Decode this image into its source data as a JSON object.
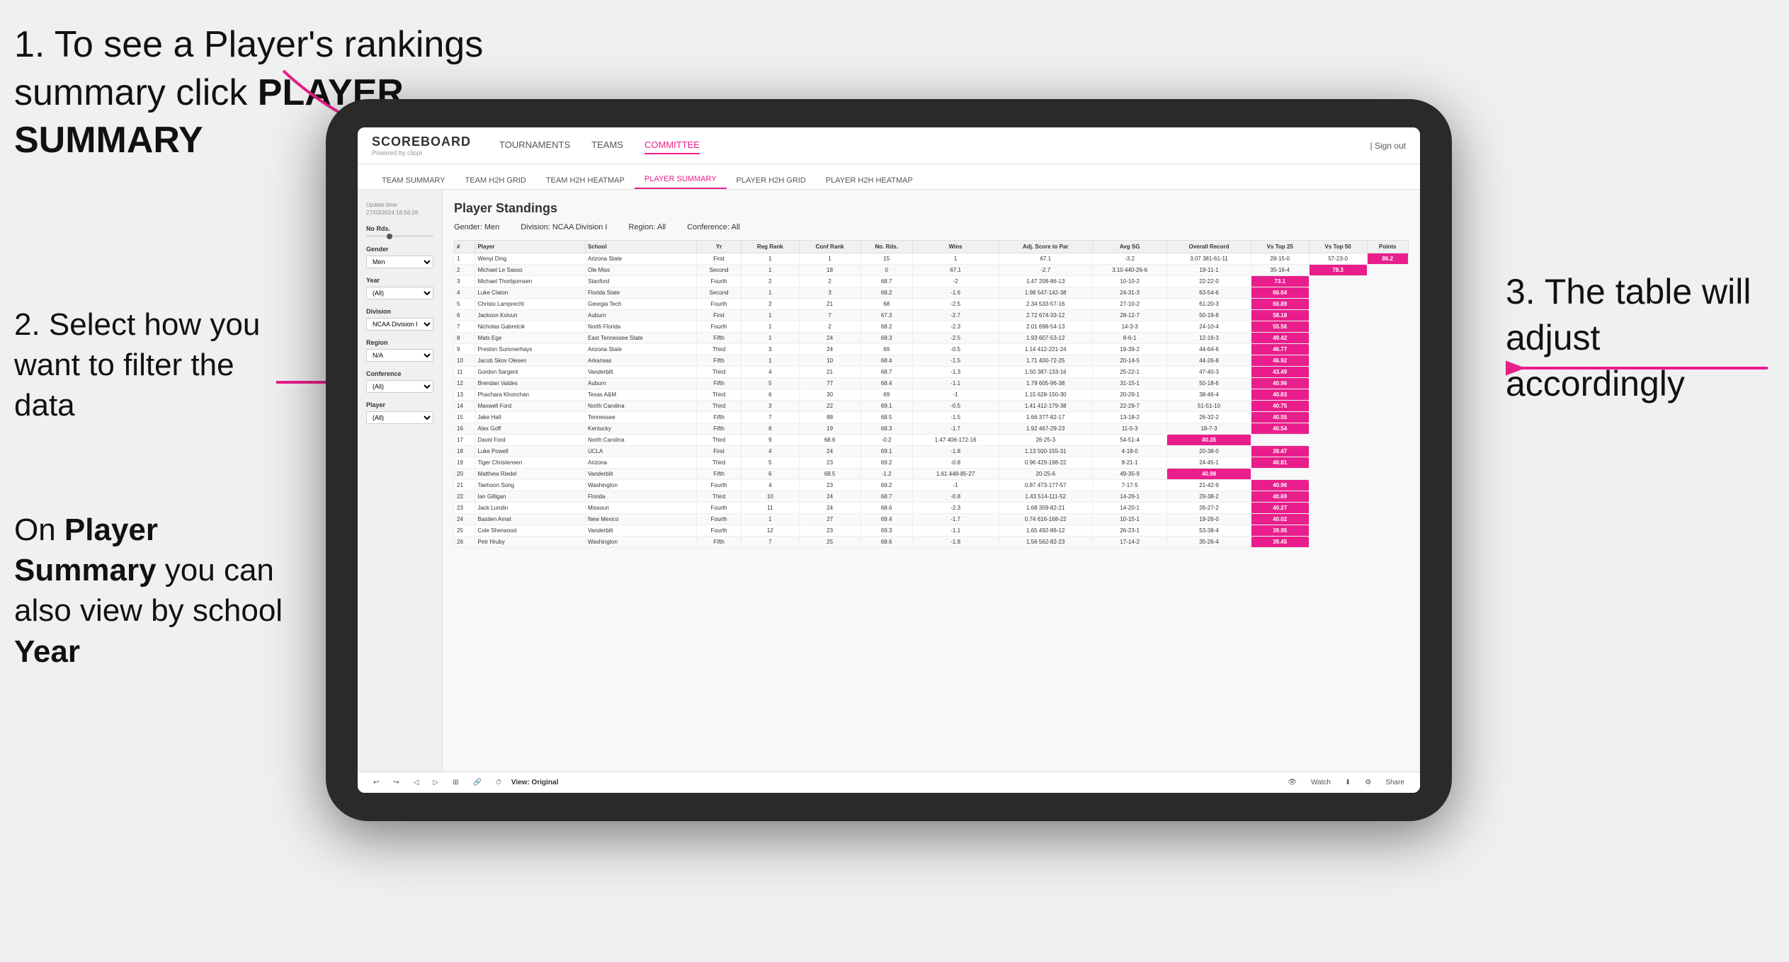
{
  "annotations": {
    "step1": "1. To see a Player's rankings summary click ",
    "step1_bold": "PLAYER SUMMARY",
    "step2_title": "2. Select how you want to filter the data",
    "step2_body_prefix": "On ",
    "step2_body_bold1": "Player Summary",
    "step2_body_mid": " you can also view by school ",
    "step2_body_bold2": "Year",
    "step3": "3. The table will adjust accordingly"
  },
  "nav": {
    "logo": "SCOREBOARD",
    "logo_sub": "Powered by clippi",
    "items": [
      "TOURNAMENTS",
      "TEAMS",
      "COMMITTEE"
    ],
    "active_item": "COMMITTEE",
    "right": [
      "| Sign out"
    ]
  },
  "sub_nav": {
    "items": [
      "TEAM SUMMARY",
      "TEAM H2H GRID",
      "TEAM H2H HEATMAP",
      "PLAYER SUMMARY",
      "PLAYER H2H GRID",
      "PLAYER H2H HEATMAP"
    ],
    "active": "PLAYER SUMMARY"
  },
  "sidebar": {
    "update_label": "Update time:",
    "update_time": "27/03/2024 16:56:26",
    "no_rds_label": "No Rds.",
    "gender_label": "Gender",
    "gender_value": "Men",
    "year_label": "Year",
    "year_value": "(All)",
    "division_label": "Division",
    "division_value": "NCAA Division I",
    "region_label": "Region",
    "region_value": "N/A",
    "conference_label": "Conference",
    "conference_value": "(All)",
    "player_label": "Player",
    "player_value": "(All)"
  },
  "table": {
    "title": "Player Standings",
    "filters": {
      "gender_label": "Gender:",
      "gender_value": "Men",
      "division_label": "Division:",
      "division_value": "NCAA Division I",
      "region_label": "Region:",
      "region_value": "All",
      "conference_label": "Conference:",
      "conference_value": "All"
    },
    "headers": [
      "#",
      "Player",
      "School",
      "Yr",
      "Reg Rank",
      "Conf Rank",
      "No. Rds.",
      "Wins",
      "Adj. Score to Par",
      "Avg SG",
      "Overall Record",
      "Vs Top 25",
      "Vs Top 50",
      "Points"
    ],
    "rows": [
      [
        1,
        "Wenyi Ding",
        "Arizona State",
        "First",
        1,
        1,
        15,
        1,
        67.1,
        -3.2,
        "3.07 381-61-11",
        "28-15-0",
        "57-23-0",
        "86.2"
      ],
      [
        2,
        "Michael Le Sasso",
        "Ole Miss",
        "Second",
        1,
        18,
        0,
        67.1,
        -2.7,
        "3.10 440-26-6",
        "19-11-1",
        "35-16-4",
        "78.3"
      ],
      [
        3,
        "Michael Thorbjornsen",
        "Stanford",
        "Fourth",
        2,
        2,
        68.7,
        -2.0,
        "1.47 208-86-13",
        "10-10-2",
        "22-22-0",
        "73.1"
      ],
      [
        4,
        "Luke Claton",
        "Florida State",
        "Second",
        1,
        3,
        68.2,
        -1.6,
        "1.98 547-142-38",
        "24-31-3",
        "63-54-6",
        "66.04"
      ],
      [
        5,
        "Christo Lamprecht",
        "Georgia Tech",
        "Fourth",
        2,
        21,
        68.0,
        -2.5,
        "2.34 533-57-16",
        "27-10-2",
        "61-20-3",
        "60.89"
      ],
      [
        6,
        "Jackson Koivun",
        "Auburn",
        "First",
        1,
        7,
        67.3,
        -2.7,
        "2.72 674-33-12",
        "28-12-7",
        "50-19-8",
        "58.18"
      ],
      [
        7,
        "Nicholas Gabrelcik",
        "North Florida",
        "Fourth",
        1,
        2,
        68.2,
        -2.3,
        "2.01 698-54-13",
        "14-3-3",
        "24-10-4",
        "55.56"
      ],
      [
        8,
        "Mats Ege",
        "East Tennessee State",
        "Fifth",
        1,
        24,
        68.3,
        -2.5,
        "1.93 607-53-12",
        "8-6-1",
        "12-16-3",
        "49.42"
      ],
      [
        9,
        "Preston Summerhays",
        "Arizona State",
        "Third",
        3,
        24,
        69.0,
        -0.5,
        "1.14 412-221-24",
        "19-39-2",
        "44-64-6",
        "46.77"
      ],
      [
        10,
        "Jacob Skov Olesen",
        "Arkansas",
        "Fifth",
        1,
        10,
        68.4,
        -1.5,
        "1.71 400-72-25",
        "20-14-5",
        "44-26-8",
        "46.92"
      ],
      [
        11,
        "Gordon Sargent",
        "Vanderbilt",
        "Third",
        4,
        21,
        68.7,
        -1.3,
        "1.50 387-133-16",
        "25-22-1",
        "47-40-3",
        "43.49"
      ],
      [
        12,
        "Brendan Valdes",
        "Auburn",
        "Fifth",
        5,
        77,
        68.4,
        -1.1,
        "1.79 605-96-38",
        "31-15-1",
        "50-18-6",
        "40.96"
      ],
      [
        13,
        "Phachara Khonchan",
        "Texas A&M",
        "Third",
        6,
        30,
        69.0,
        -1.0,
        "1.15 628-150-30",
        "20-29-1",
        "38-46-4",
        "40.83"
      ],
      [
        14,
        "Maxwell Ford",
        "North Carolina",
        "Third",
        3,
        22,
        69.1,
        -0.5,
        "1.41 412-179-38",
        "22-29-7",
        "51-51-10",
        "40.75"
      ],
      [
        15,
        "Jake Hall",
        "Tennessee",
        "Fifth",
        7,
        88,
        68.5,
        -1.5,
        "1.66 377-82-17",
        "13-18-2",
        "26-32-2",
        "40.55"
      ],
      [
        16,
        "Alex Goff",
        "Kentucky",
        "Fifth",
        8,
        19,
        68.3,
        -1.7,
        "1.92 467-29-23",
        "11-5-3",
        "18-7-3",
        "40.54"
      ],
      [
        17,
        "David Ford",
        "North Carolina",
        "Third",
        9,
        68.6,
        -0.2,
        "1.47 406-172-16",
        "26-25-3",
        "54-51-4",
        "40.35"
      ],
      [
        18,
        "Luke Powell",
        "UCLA",
        "First",
        4,
        24,
        69.1,
        -1.8,
        "1.13 500-155-31",
        "4-18-0",
        "20-38-0",
        "39.47"
      ],
      [
        19,
        "Tiger Christensen",
        "Arizona",
        "Third",
        5,
        23,
        69.2,
        -0.8,
        "0.96 429-198-22",
        "8-21-1",
        "24-45-1",
        "40.81"
      ],
      [
        20,
        "Matthew Riedel",
        "Vanderbilt",
        "Fifth",
        6,
        68.5,
        -1.2,
        "1.61 448-85-27",
        "20-25-6",
        "49-35-9",
        "40.98"
      ],
      [
        21,
        "Taehoon Song",
        "Washington",
        "Fourth",
        4,
        23,
        69.2,
        -1.0,
        "0.87 473-177-57",
        "7-17-5",
        "21-42-9",
        "40.96"
      ],
      [
        22,
        "Ian Gilligan",
        "Florida",
        "Third",
        10,
        24,
        68.7,
        -0.8,
        "1.43 514-111-52",
        "14-26-1",
        "29-38-2",
        "40.69"
      ],
      [
        23,
        "Jack Lundin",
        "Missouri",
        "Fourth",
        11,
        24,
        68.6,
        -2.3,
        "1.68 309-82-21",
        "14-20-1",
        "26-27-2",
        "40.27"
      ],
      [
        24,
        "Bastien Amat",
        "New Mexico",
        "Fourth",
        1,
        27,
        69.4,
        -1.7,
        "0.74 616-168-22",
        "10-15-1",
        "19-26-0",
        "40.02"
      ],
      [
        25,
        "Cole Sherwood",
        "Vanderbilt",
        "Fourth",
        12,
        23,
        69.3,
        -1.1,
        "1.65 492-86-12",
        "26-23-1",
        "53-38-4",
        "39.95"
      ],
      [
        26,
        "Petr Hruby",
        "Washington",
        "Fifth",
        7,
        25,
        68.6,
        -1.8,
        "1.56 562-82-23",
        "17-14-2",
        "35-26-4",
        "39.45"
      ]
    ]
  },
  "toolbar": {
    "view_label": "View: Original",
    "watch_label": "Watch",
    "share_label": "Share"
  }
}
